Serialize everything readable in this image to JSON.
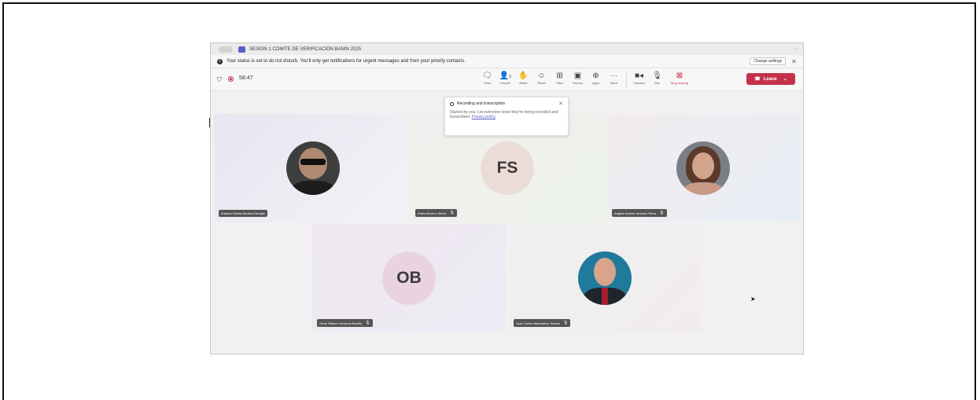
{
  "window": {
    "title": "SESION 1 COMITE DE VERIFICACION BANIN 2025"
  },
  "banner": {
    "message": "Your status is set to do not disturb. You'll only get notifications for urgent messages and from your priority contacts.",
    "change_settings_label": "Change settings"
  },
  "meeting": {
    "timer": "58:47",
    "leave_label": "Leave"
  },
  "toolbar": {
    "chat": "Chat",
    "people": "People",
    "people_count": "5",
    "raise": "Raise",
    "react": "React",
    "view": "View",
    "rooms": "Rooms",
    "apps": "Apps",
    "more": "More",
    "camera": "Camera",
    "mic": "Mic",
    "stop_sharing": "Stop sharing"
  },
  "popup": {
    "title": "Recording and transcription",
    "body": "Started by you. Let everyone know they're being recorded and transcribed.",
    "link": "Privacy policy"
  },
  "participants": [
    {
      "name": "Edward Fabian Medina Barajas",
      "initials": "",
      "muted": false
    },
    {
      "name": "Fabio Moreno Sierra",
      "initials": "FS",
      "muted": true
    },
    {
      "name": "Angela Andrea Jimenez Parra",
      "initials": "",
      "muted": true
    },
    {
      "name": "Omar Wilson Carranza Bolaño",
      "initials": "OB",
      "muted": true
    },
    {
      "name": "Juan Carlos Baracaldos Santos",
      "initials": "",
      "muted": true
    }
  ],
  "icons": {
    "chat": "chat-icon",
    "people": "people-icon",
    "raise": "raise-hand-icon",
    "react": "react-icon",
    "view": "view-icon",
    "rooms": "rooms-icon",
    "apps": "apps-icon",
    "more": "more-icon",
    "camera": "camera-icon",
    "mic": "mic-icon",
    "stop_sharing": "stop-sharing-icon"
  },
  "colors": {
    "leave": "#c4314b",
    "accent": "#5b5fc7"
  }
}
